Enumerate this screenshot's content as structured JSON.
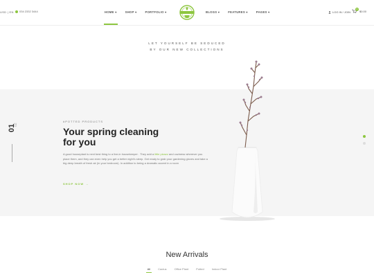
{
  "header": {
    "lang": "USD | EN",
    "phone": "034 2332 3444",
    "nav_left": [
      "HOME ▾",
      "SHOP ▾",
      "PORTFOLIO ▾"
    ],
    "nav_right": [
      "BLOGS ▾",
      "FEATURES ▾",
      "PAGES ▾"
    ],
    "account": "LOG IN / JOIN",
    "cart_count": "0",
    "cart_total": "$0.00"
  },
  "tagline": {
    "line1": "LET YOURSELF BE SEDUCED",
    "line2": "BY OUR NEW COLLECTIONS"
  },
  "hero": {
    "slide_current": "01",
    "slide_total": "02",
    "eyebrow": "#POTTED PRODUCTS",
    "headline_line1": "Your spring cleaning",
    "headline_line2": "for you",
    "desc_start": "A good houseplant is next best thing to a live-in housekeeper . They add a ",
    "desc_highlight": "little pizazz",
    "desc_end": " and coziness wherever you place them, and they can even help you get a better night's sleep. Get ready to grab your gardening gloves and take a big deep breath of fresh air (in your bedroom). In addition to being a dramatic accent in a room",
    "cta": "SHOP NOW →"
  },
  "arrivals": {
    "title": "New Arrivals",
    "filters": [
      "All",
      "Cactus",
      "Office Plant",
      "Potted",
      "Indoor Plant"
    ]
  },
  "colors": {
    "accent": "#8dc63f",
    "hero_bg": "#f5f5f5"
  },
  "icons": [
    "phone-icon",
    "user-icon",
    "cart-icon",
    "logo-badge"
  ]
}
